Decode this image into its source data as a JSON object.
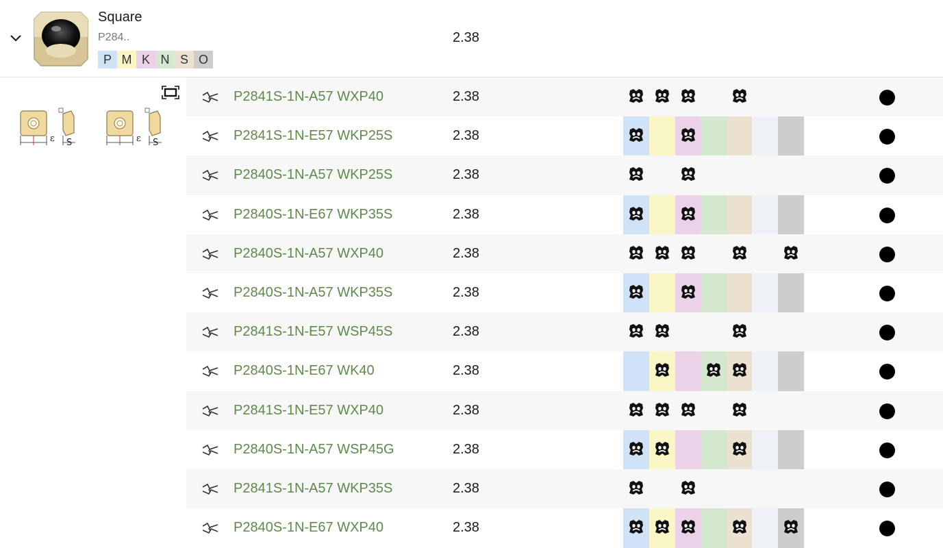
{
  "group": {
    "title": "Square",
    "code": "P284..",
    "value": "2.38",
    "iso_badges": [
      {
        "label": "P",
        "color": "#cfe2f6"
      },
      {
        "label": "M",
        "color": "#fbf6c6"
      },
      {
        "label": "K",
        "color": "#ecd2e8"
      },
      {
        "label": "N",
        "color": "#d4e8d0"
      },
      {
        "label": "S",
        "color": "#ece1d0"
      },
      {
        "label": "O",
        "color": "#cdcdcd"
      }
    ]
  },
  "sketch_labels": {
    "epsilon": "ε",
    "s": "S"
  },
  "iso_columns": [
    {
      "key": "P",
      "color": "#cfe2f6"
    },
    {
      "key": "M",
      "color": "#fbf6c6"
    },
    {
      "key": "K",
      "color": "#ecd2e8"
    },
    {
      "key": "N",
      "color": "#d4e8d0"
    },
    {
      "key": "S",
      "color": "#ece1d0"
    },
    {
      "key": "H",
      "color": "#eef2f7"
    },
    {
      "key": "O",
      "color": "#cdcdcd"
    }
  ],
  "rows": [
    {
      "code": "P2841S-1N-A57 WXP40",
      "value": "2.38",
      "marks": [
        "P",
        "M",
        "K",
        "S"
      ]
    },
    {
      "code": "P2841S-1N-E57 WKP25S",
      "value": "2.38",
      "marks": [
        "P",
        "K"
      ]
    },
    {
      "code": "P2840S-1N-A57 WKP25S",
      "value": "2.38",
      "marks": [
        "P",
        "K"
      ]
    },
    {
      "code": "P2840S-1N-E67 WKP35S",
      "value": "2.38",
      "marks": [
        "P",
        "K"
      ]
    },
    {
      "code": "P2840S-1N-A57 WXP40",
      "value": "2.38",
      "marks": [
        "P",
        "M",
        "K",
        "S",
        "O"
      ]
    },
    {
      "code": "P2840S-1N-A57 WKP35S",
      "value": "2.38",
      "marks": [
        "P",
        "K"
      ]
    },
    {
      "code": "P2841S-1N-E57 WSP45S",
      "value": "2.38",
      "marks": [
        "P",
        "M",
        "S"
      ]
    },
    {
      "code": "P2840S-1N-E67 WK40",
      "value": "2.38",
      "marks": [
        "M",
        "N",
        "S"
      ]
    },
    {
      "code": "P2841S-1N-E57 WXP40",
      "value": "2.38",
      "marks": [
        "P",
        "M",
        "K",
        "S"
      ]
    },
    {
      "code": "P2840S-1N-A57 WSP45G",
      "value": "2.38",
      "marks": [
        "P",
        "M",
        "S"
      ]
    },
    {
      "code": "P2841S-1N-A57 WKP35S",
      "value": "2.38",
      "marks": [
        "P",
        "K"
      ]
    },
    {
      "code": "P2840S-1N-E67 WXP40",
      "value": "2.38",
      "marks": [
        "P",
        "M",
        "K",
        "S",
        "O"
      ]
    }
  ]
}
